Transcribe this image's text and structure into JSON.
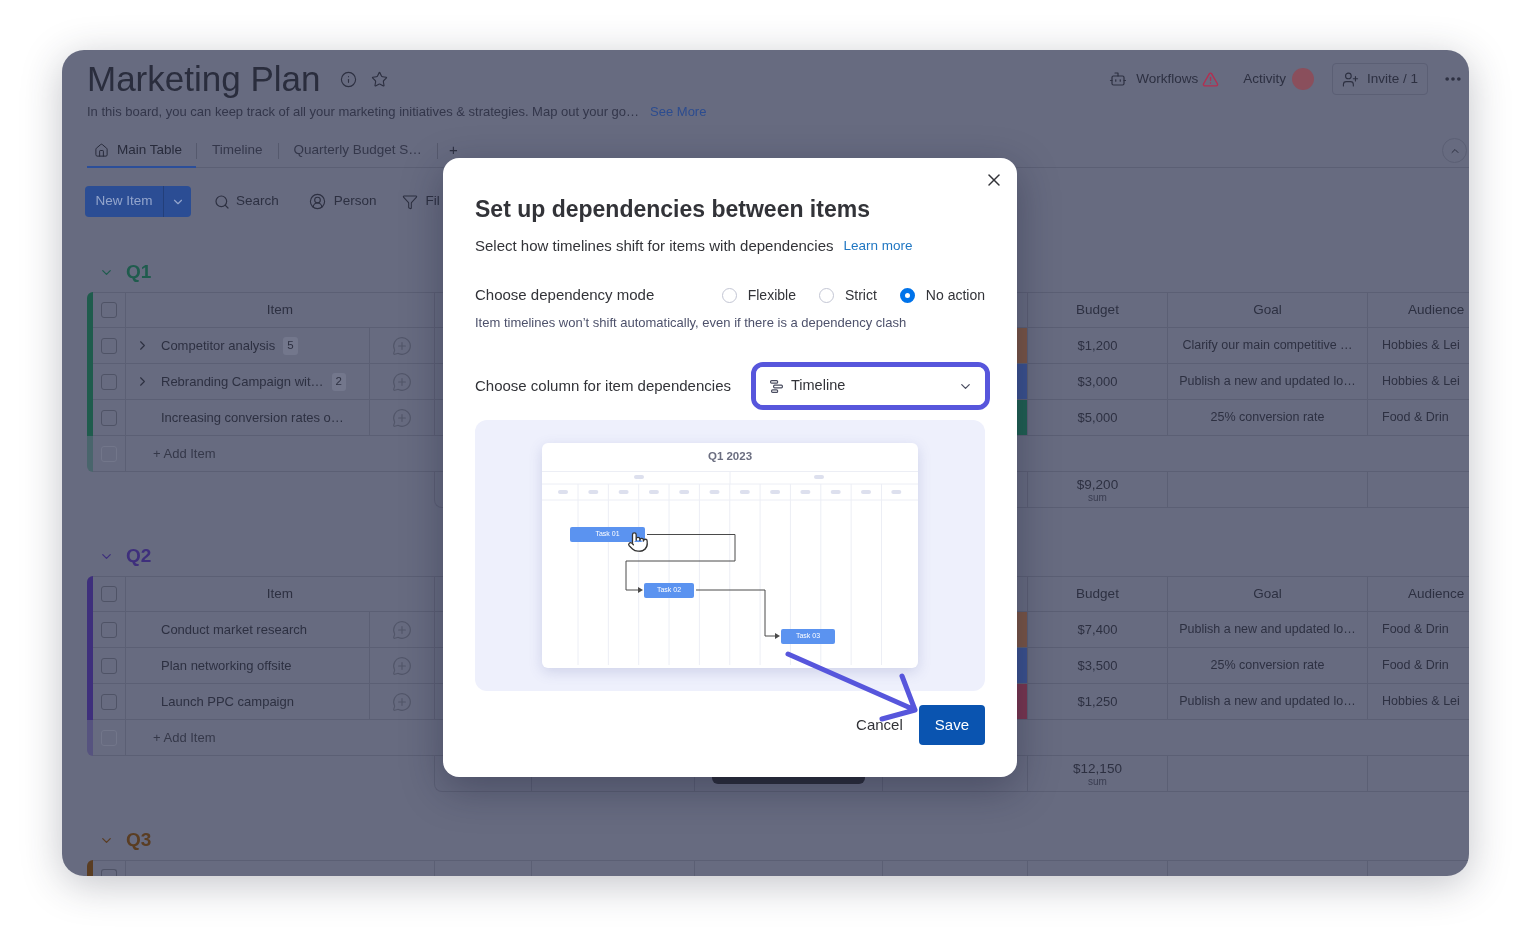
{
  "board": {
    "title": "Marketing Plan",
    "description": "In this board, you can keep track of all your marketing initiatives & strategies. Map out your go…",
    "see_more": "See More"
  },
  "header_actions": {
    "workflows": "Workflows",
    "workflows_alert": true,
    "activity": "Activity",
    "invite": "Invite / 1"
  },
  "tabs": [
    {
      "label": "Main Table",
      "selected": true,
      "kind": "home"
    },
    {
      "label": "Timeline",
      "selected": false,
      "kind": "plain"
    },
    {
      "label": "Quarterly Budget S…",
      "selected": false,
      "kind": "plain"
    }
  ],
  "add_tab": "+",
  "toolbar": {
    "new_item": "New Item",
    "search": "Search",
    "person": "Person",
    "filter": "Fil"
  },
  "groups": [
    {
      "name": "Q1",
      "color": "#1f5c4d",
      "expanded": true,
      "all_checked": false,
      "columns": {
        "item": "Item",
        "budget": "Budget",
        "goal": "Goal",
        "audience": "Audience"
      },
      "rows": [
        {
          "name": "Competitor analysis",
          "subitems": "5",
          "checked": false,
          "color": "#7a5646",
          "budget": "$1,200",
          "goal": "Clarify our main competitive …",
          "audience": "Hobbies & Lei"
        },
        {
          "name": "Rebranding Campaign wit…",
          "subitems": "2",
          "checked": false,
          "color": "#3b5290",
          "budget": "$3,000",
          "goal": "Publish a new and updated lo…",
          "audience": "Hobbies & Lei"
        },
        {
          "name": "Increasing conversion rates o…",
          "checked": false,
          "color": "#1f6152",
          "budget": "$5,000",
          "goal": "25% conversion rate",
          "audience": "Food & Drin"
        }
      ],
      "add_item": {
        "label": "+ Add Item",
        "checked": false
      },
      "sum": {
        "value": "$9,200",
        "label": "sum"
      }
    },
    {
      "name": "Q2",
      "color": "#3e2f7c",
      "expanded": true,
      "all_checked": false,
      "columns": {
        "item": "Item",
        "budget": "Budget",
        "goal": "Goal",
        "audience": "Audience"
      },
      "rows": [
        {
          "name": "Conduct market research",
          "checked": false,
          "color": "#7a5646",
          "budget": "$7,400",
          "goal": "Publish a new and updated lo…",
          "audience": "Food & Drin"
        },
        {
          "name": "Plan networking offsite",
          "checked": false,
          "color": "#3b5290",
          "budget": "$3,500",
          "goal": "25% conversion rate",
          "audience": "Food & Drin"
        },
        {
          "name": "Launch PPC campaign",
          "checked": false,
          "color": "#7a3650",
          "budget": "$1,250",
          "goal": "Publish a new and updated lo…",
          "audience": "Hobbies & Lei"
        }
      ],
      "add_item": {
        "label": "+ Add Item",
        "checked": false
      },
      "sum": {
        "value": "$12,150",
        "label": "sum"
      }
    },
    {
      "name": "Q3",
      "color": "#5a3d22",
      "expanded": true,
      "all_checked": false
    }
  ],
  "dialog": {
    "title": "Set up dependencies between items",
    "subtitle": "Select how timelines shift for items with dependencies",
    "learn_more": "Learn more",
    "mode_label": "Choose dependency mode",
    "modes": [
      {
        "label": "Flexible",
        "selected": false
      },
      {
        "label": "Strict",
        "selected": false
      },
      {
        "label": "No action",
        "selected": true
      }
    ],
    "mode_hint": "Item timelines won’t shift automatically, even if there is a dependency clash",
    "column_label": "Choose column for item dependencies",
    "column_value": "Timeline",
    "illustration": {
      "title": "Q1 2023",
      "tasks": [
        "Task 01",
        "Task 02",
        "Task 03"
      ]
    },
    "buttons": [
      {
        "label": "Cancel",
        "kind": "secondary"
      },
      {
        "label": "Save",
        "kind": "primary"
      }
    ]
  }
}
